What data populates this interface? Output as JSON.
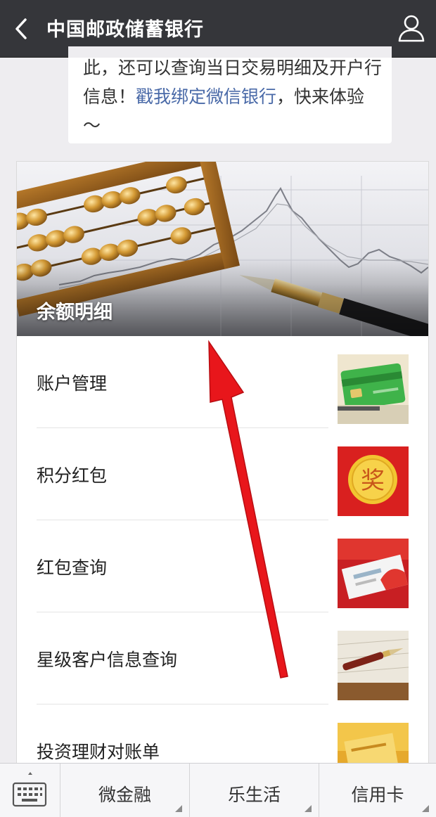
{
  "header": {
    "title": "中国邮政储蓄银行"
  },
  "message": {
    "text_before_link": "此，还可以查询当日交易明细及开户行信息！",
    "link_text": "戳我绑定微信银行",
    "text_after_link": "，快来体验～"
  },
  "card": {
    "banner_title": "余额明细",
    "items": [
      {
        "label": "账户管理",
        "thumb_icon": "bank-card-thumbnail"
      },
      {
        "label": "积分红包",
        "thumb_icon": "red-packet-award-thumbnail",
        "thumb_text": "奖"
      },
      {
        "label": "红包查询",
        "thumb_icon": "red-envelope-thumbnail"
      },
      {
        "label": "星级客户信息查询",
        "thumb_icon": "fountain-pen-thumbnail"
      },
      {
        "label": "投资理财对账单",
        "thumb_icon": "gold-document-thumbnail"
      }
    ]
  },
  "bottom_menu": {
    "keyboard_icon": "keyboard-icon",
    "items": [
      "微金融",
      "乐生活",
      "信用卡"
    ]
  },
  "colors": {
    "topbar": "#35363a",
    "link": "#4a6aa8",
    "annotation_arrow": "#e8161b"
  }
}
